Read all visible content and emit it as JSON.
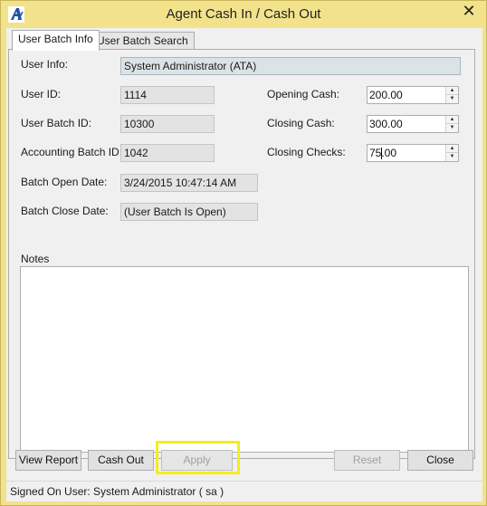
{
  "window": {
    "title": "Agent Cash In / Cash Out",
    "close_glyph": "✕",
    "app_icon": "app-logo-icon",
    "title_bar_color": "#f2e28c"
  },
  "tabs": [
    {
      "label": "User Batch Info",
      "active": true
    },
    {
      "label": "User Batch Search",
      "active": false
    }
  ],
  "form": {
    "user_info_label": "User Info:",
    "user_info_value": "System Administrator (ATA)",
    "user_id_label": "User ID:",
    "user_id_value": "1114",
    "user_batch_id_label": "User Batch ID:",
    "user_batch_id_value": "10300",
    "accounting_batch_id_label": "Accounting Batch ID:",
    "accounting_batch_id_value": "1042",
    "batch_open_date_label": "Batch Open Date:",
    "batch_open_date_value": "3/24/2015 10:47:14 AM",
    "batch_close_date_label": "Batch Close Date:",
    "batch_close_date_value": "(User Batch Is Open)",
    "opening_cash_label": "Opening Cash:",
    "opening_cash_value": "200.00",
    "closing_cash_label": "Closing Cash:",
    "closing_cash_value": "300.00",
    "closing_checks_label": "Closing Checks:",
    "closing_checks_value": "75.00",
    "notes_label": "Notes",
    "notes_value": ""
  },
  "buttons": {
    "view_report": "View Report",
    "cash_out": "Cash Out",
    "apply": "Apply",
    "reset": "Reset",
    "close": "Close"
  },
  "highlight_color": "#f2ee1e",
  "status": {
    "text": "Signed On User: System Administrator ( sa )"
  }
}
